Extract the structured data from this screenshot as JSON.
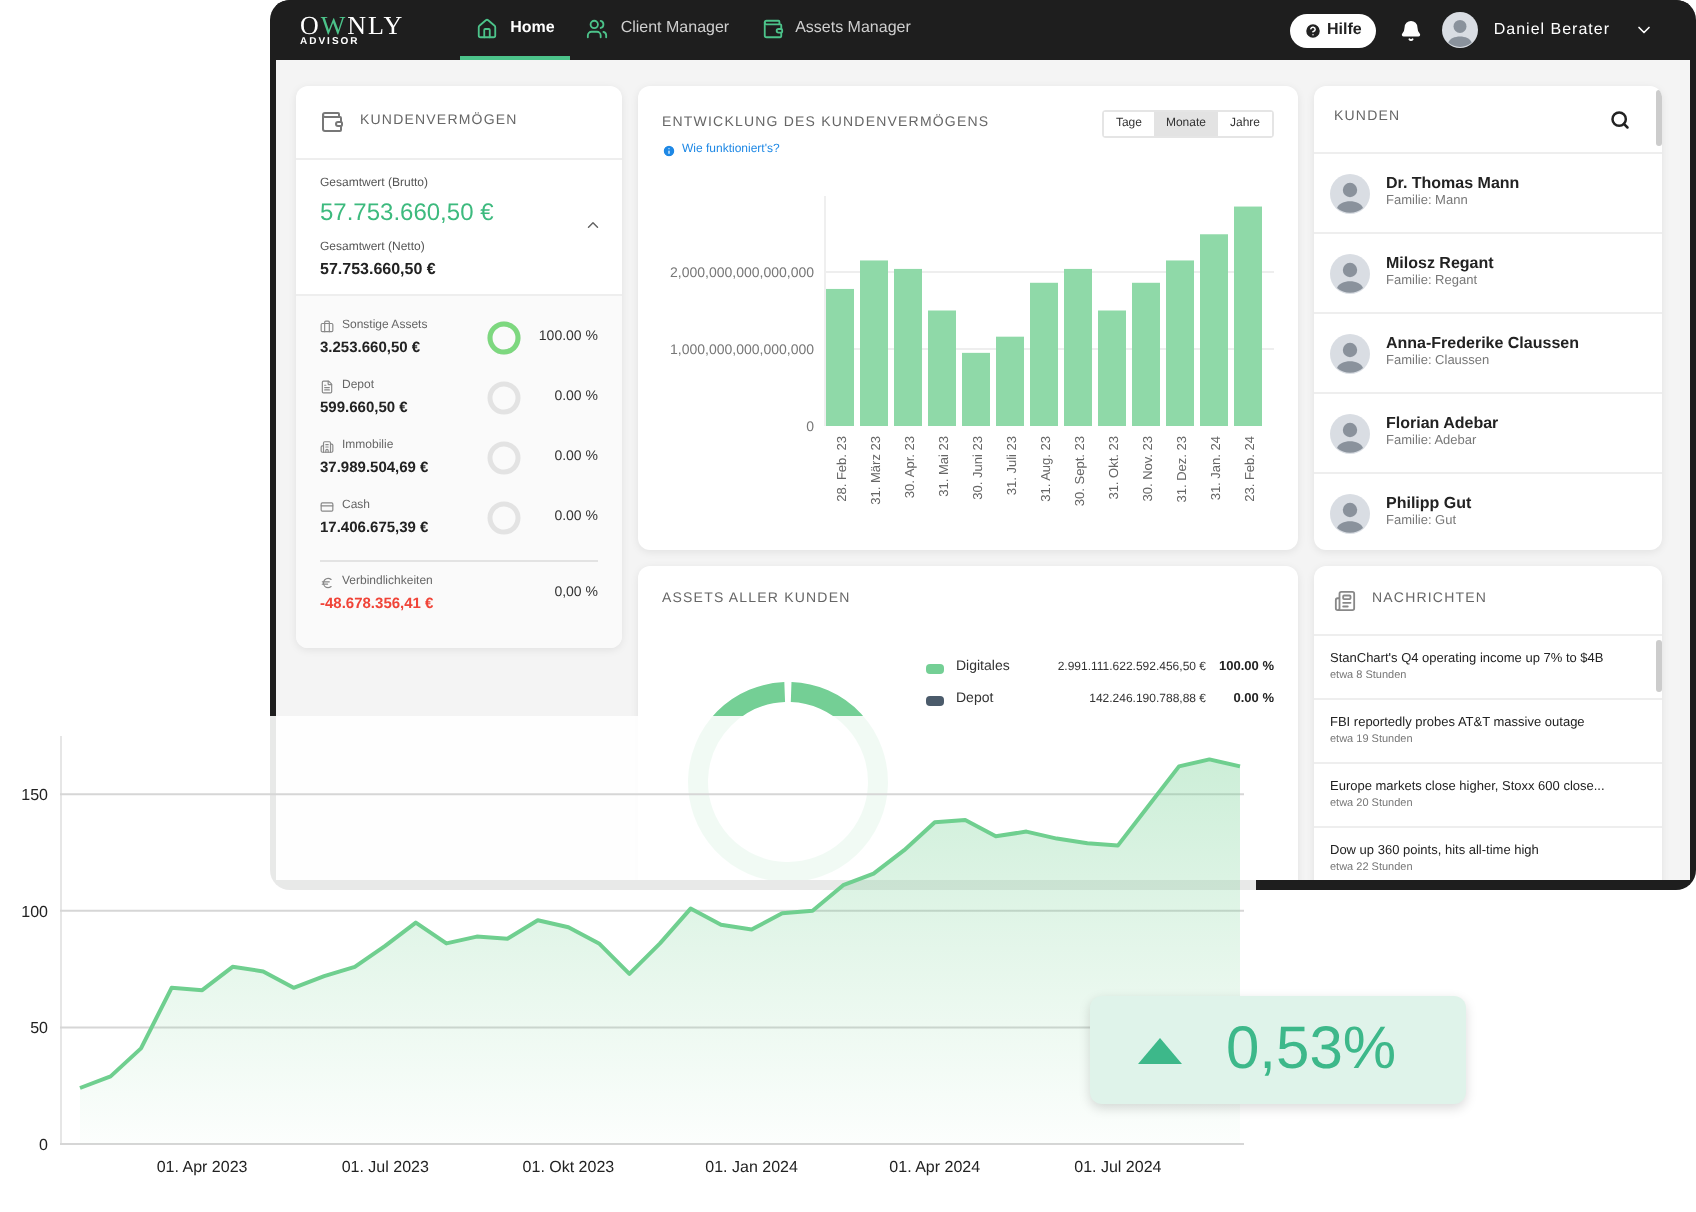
{
  "nav": {
    "logo": [
      {
        "text": "O",
        "accent": false
      },
      {
        "text": "W",
        "accent": true
      },
      {
        "text": "NLY",
        "accent": false
      }
    ],
    "logo_sub": "ADVISOR",
    "items": [
      {
        "label": "Home",
        "selected": true
      },
      {
        "label": "Client Manager",
        "selected": false
      },
      {
        "label": "Assets Manager",
        "selected": false
      }
    ],
    "help": "Hilfe",
    "user": "Daniel Berater"
  },
  "wealth": {
    "title": "KUNDENVERMÖGEN",
    "gross_label": "Gesamtwert (Brutto)",
    "gross": "57.753.660,50 €",
    "net_label": "Gesamtwert (Netto)",
    "net": "57.753.660,50 €",
    "expanded": true,
    "assets": [
      {
        "label": "Sonstige Assets",
        "value": "3.253.660,50 €",
        "level": 1,
        "share": "100.00 %"
      },
      {
        "label": "Depot",
        "value": "599.660,50 €",
        "level": 0,
        "share": "0.00 %"
      },
      {
        "label": "Immobilie",
        "value": "37.989.504,69 €",
        "level": 0,
        "share": "0.00 %"
      },
      {
        "label": "Cash",
        "value": "17.406.675,39 €",
        "level": 0,
        "share": "0.00 %"
      }
    ],
    "liabilities": {
      "label": "Verbindlichkeiten",
      "value": "-48.678.356,41 €",
      "share": "0,00 %"
    }
  },
  "development": {
    "title": "ENTWICKLUNG DES KUNDENVERMÖGENS",
    "help_link": "Wie funktioniert's?",
    "ranges": [
      {
        "label": "Tage",
        "selected": false
      },
      {
        "label": "Monate",
        "selected": true
      },
      {
        "label": "Jahre",
        "selected": false
      }
    ],
    "chart_data": {
      "type": "bar",
      "categories": [
        "28. Feb. 23",
        "31. März 23",
        "30. Apr. 23",
        "31. Mai 23",
        "30. Juni 23",
        "31. Juli 23",
        "31. Aug. 23",
        "30. Sept. 23",
        "31. Okt. 23",
        "30. Nov. 23",
        "31. Dez. 23",
        "31. Jan. 24",
        "23. Feb. 24"
      ],
      "series": [
        {
          "color": "#8fd9a8",
          "values": [
            1780000000000000,
            2150000000000000,
            2040000000000000,
            1500000000000000,
            950000000000000,
            1160000000000000,
            1860000000000000,
            2040000000000000,
            1500000000000000,
            1860000000000000,
            2150000000000000,
            2490000000000000,
            2850000000000000
          ]
        }
      ],
      "ylim": [
        0,
        3000000000000000
      ],
      "grid": true,
      "yticks": [
        {
          "value": 0,
          "label": "0"
        },
        {
          "value": 1000000000000000,
          "label": "1,000,000,000,000,000"
        },
        {
          "value": 2000000000000000,
          "label": "2,000,000,000,000,000"
        }
      ]
    }
  },
  "customers": {
    "title": "KUNDEN",
    "items": [
      {
        "name": "Dr. Thomas Mann",
        "family": "Familie: Mann"
      },
      {
        "name": "Milosz Regant",
        "family": "Familie: Regant"
      },
      {
        "name": "Anna-Frederike Claussen",
        "family": "Familie: Claussen"
      },
      {
        "name": "Florian Adebar",
        "family": "Familie: Adebar"
      },
      {
        "name": "Philipp Gut",
        "family": "Familie: Gut"
      }
    ]
  },
  "assets_all": {
    "title": "ASSETS ALLER KUNDEN",
    "legend": [
      {
        "label": "Digitales",
        "value": "2.991.111.622.592.456,50 €",
        "share": "100.00 %",
        "color": "#74cf95"
      },
      {
        "label": "Depot",
        "value": "142.246.190.788,88 €",
        "share": "0.00 %",
        "color": "#4b5b6b"
      }
    ]
  },
  "news": {
    "title": "NACHRICHTEN",
    "items": [
      {
        "title": "StanChart's Q4 operating income up 7% to $4B",
        "time": "etwa 8 Stunden"
      },
      {
        "title": "FBI reportedly probes AT&T massive outage",
        "time": "etwa 19 Stunden"
      },
      {
        "title": "Europe markets close higher, Stoxx 600 close...",
        "time": "etwa 20 Stunden"
      },
      {
        "title": "Dow up 360 points, hits all-time high",
        "time": "etwa 22 Stunden"
      }
    ]
  },
  "performance": {
    "chart_data": {
      "type": "area",
      "categories": [
        null,
        null,
        null,
        null,
        "01. Apr 2023",
        null,
        null,
        null,
        null,
        null,
        "01. Jul 2023",
        null,
        null,
        null,
        null,
        null,
        "01. Okt 2023",
        null,
        null,
        null,
        null,
        null,
        "01. Jan 2024",
        null,
        null,
        null,
        null,
        null,
        "01. Apr 2024",
        null,
        null,
        null,
        null,
        null,
        "01. Jul 2024",
        null,
        null,
        null,
        null
      ],
      "series": [
        {
          "color": "#6fcf8f",
          "values": [
            24,
            29,
            41,
            67,
            66,
            76,
            74,
            67,
            72,
            76,
            85,
            95,
            86,
            89,
            88,
            96,
            93,
            86,
            73,
            86,
            101,
            94,
            92,
            99,
            100,
            111,
            116,
            126,
            138,
            139,
            132,
            134,
            131,
            129,
            128,
            145,
            162,
            165,
            162
          ]
        }
      ],
      "ylim": [
        0,
        175
      ],
      "yticks": [
        0,
        50,
        100,
        150
      ],
      "grid": true
    },
    "badge": {
      "value": "0,53%",
      "rising": true
    }
  }
}
